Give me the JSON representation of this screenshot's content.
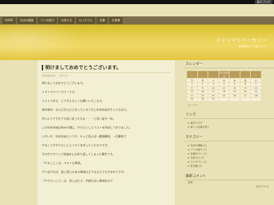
{
  "topbar": {
    "badge": "楽天ブログ"
  },
  "nav": {
    "items": [
      "HOME",
      "お店の概要",
      "パンの紹介",
      "お知らせ",
      "ひっそりと",
      "定番",
      "お客様"
    ]
  },
  "header": {
    "title": "ミドリマツベーカリー",
    "tagline": "地域密着のパン屋さんです"
  },
  "post": {
    "title": "明けましておめでとうございます。",
    "date": "2023/01/01",
    "category": "カテゴリ",
    "paragraphs": [
      "明けましておめでとうございます。",
      "ミドリマツベーカリーです。",
      "２０２３年も、どうぞよろしくお願いいたします。",
      "毎年毎年、なんだかんだと言っているうちに年末年始がやってきます。",
      "早いようでそれでも長いあったなぁ・・・と思い返す一年。",
      "この年末年始は休みの間に、やりたいことリストを作成しておりました。",
      "いやいや、年末年始というか、もっと見えば一番開幕前、一回事前で",
      "やることややりたいことリストを作っていたのですが、",
      "その中ですべって前進めにお祈り返してしまった事件です。",
      "「やること」は、マストな事項。",
      "やらなければ、誰し困らのある事項などでなるとでもかめのですが、",
      "「やりたいこと」は、思し出たり、京都のない事項なので"
    ]
  },
  "sidebar": {
    "calendar": {
      "title": "カレンダー",
      "head": [
        "＜",
        "",
        "",
        "2023年1月",
        "",
        "",
        "＞"
      ],
      "weekdays": [
        "日",
        "月",
        "火",
        "水",
        "木",
        "金",
        "土"
      ],
      "rows": [
        [
          "1",
          "2",
          "3",
          "4",
          "5",
          "6",
          "7"
        ],
        [
          "8",
          "9",
          "10",
          "11",
          "12",
          "13",
          "14"
        ],
        [
          "15",
          "16",
          "17",
          "18",
          "19",
          "20",
          "21"
        ],
        [
          "22",
          "23",
          "24",
          "25",
          "26",
          "27",
          "28"
        ],
        [
          "29",
          "30",
          "31",
          "",
          "",
          "",
          ""
        ]
      ],
      "footer": "カレンダー"
    },
    "links": {
      "title": "リンク",
      "items": [
        "楽天ブログ",
        "新しい記事を書く"
      ]
    },
    "categories": {
      "title": "カテゴリー",
      "items": [
        "お店の情報 (2)",
        "パンの紹介 (1)",
        "定番のパン (1)",
        "お知らせ (3)",
        "ひっそりと (1)",
        "未分類 (2)"
      ]
    },
    "recent": {
      "title": "最新コメント",
      "rows": [
        {
          "name": "名前",
          "date": ""
        },
        {
          "name": "",
          "date": "[2023.1.1]"
        }
      ]
    }
  },
  "colors": {
    "background": "#e9e2b8",
    "nav": "#7c6e4a",
    "header": "#e3c640",
    "content": "#f3efd4"
  }
}
